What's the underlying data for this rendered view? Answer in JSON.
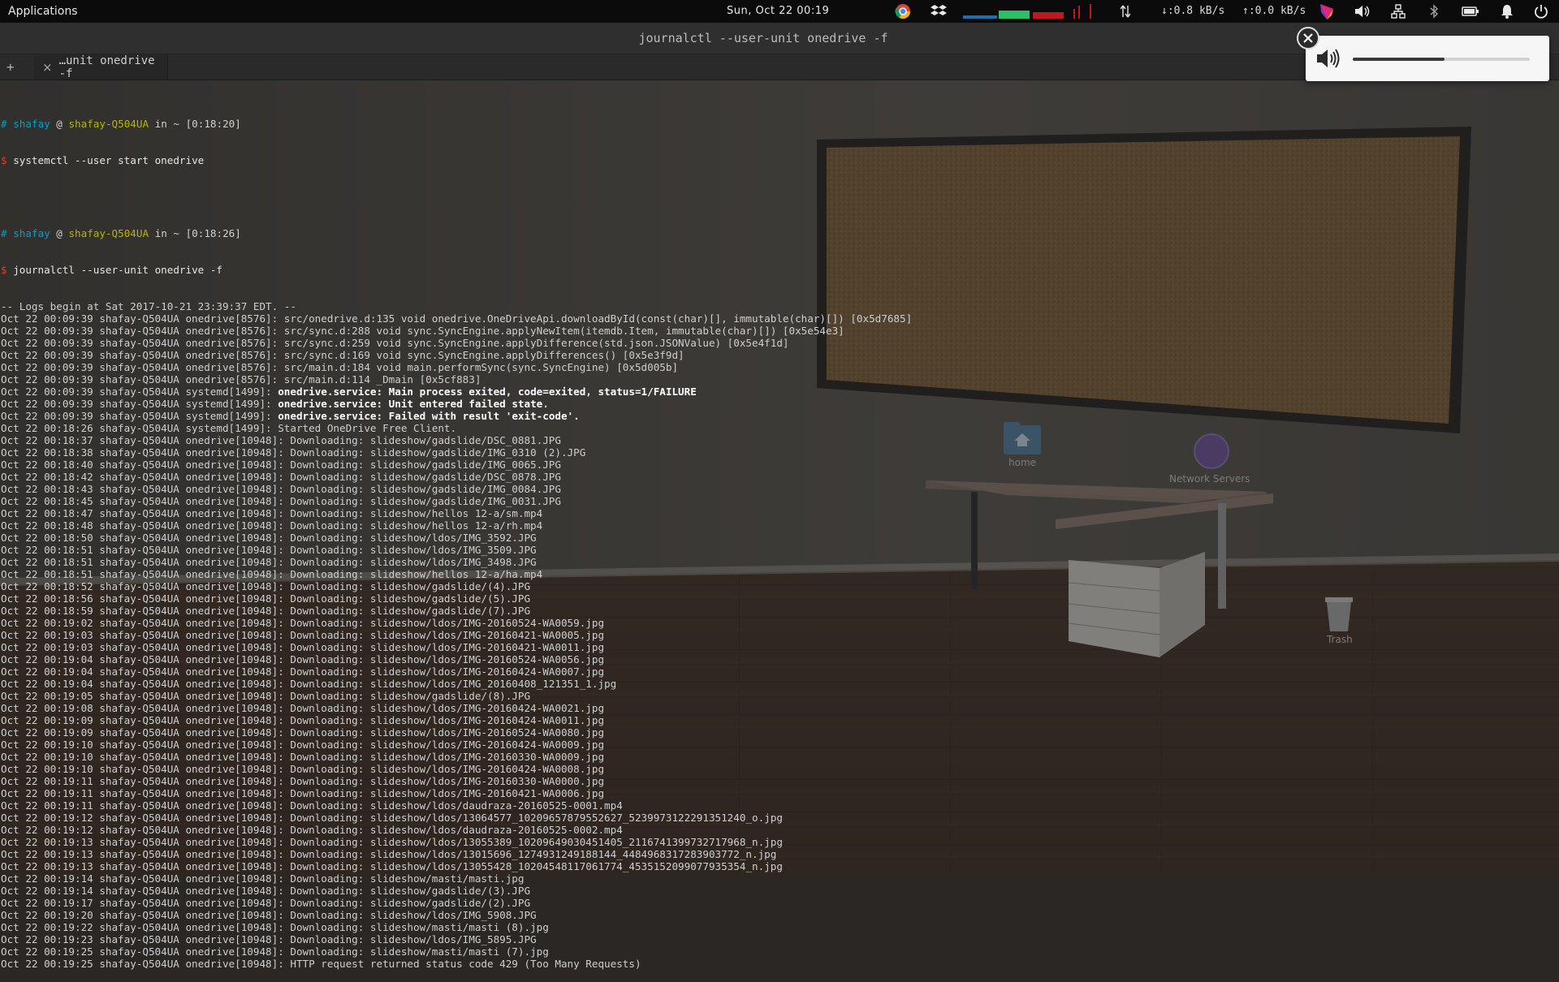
{
  "panel": {
    "apps_label": "Applications",
    "clock": "Sun, Oct 22  00:19",
    "download_speed": "↓:0.8 kB/s",
    "upload_speed": "↑:0.0 kB/s"
  },
  "terminal": {
    "title": "journalctl --user-unit onedrive -f",
    "new_tab_symbol": "+",
    "close_tab_symbol": "×",
    "tab_label": "…unit onedrive -f",
    "prompts": [
      {
        "hash": "#",
        "user": "shafay",
        "at": "@",
        "host": "shafay-Q504UA",
        "in": "in",
        "path": "~",
        "time": "[0:18:20]",
        "dollar": "$",
        "command": "systemctl --user start onedrive"
      },
      {
        "hash": "#",
        "user": "shafay",
        "at": "@",
        "host": "shafay-Q504UA",
        "in": "in",
        "path": "~",
        "time": "[0:18:26]",
        "dollar": "$",
        "command": "journalctl --user-unit onedrive -f"
      }
    ],
    "log_lines": [
      "-- Logs begin at Sat 2017-10-21 23:39:37 EDT. --",
      "Oct 22 00:09:39 shafay-Q504UA onedrive[8576]: src/onedrive.d:135 void onedrive.OneDriveApi.downloadById(const(char)[], immutable(char)[]) [0x5d7685]",
      "Oct 22 00:09:39 shafay-Q504UA onedrive[8576]: src/sync.d:288 void sync.SyncEngine.applyNewItem(itemdb.Item, immutable(char)[]) [0x5e54e3]",
      "Oct 22 00:09:39 shafay-Q504UA onedrive[8576]: src/sync.d:259 void sync.SyncEngine.applyDifference(std.json.JSONValue) [0x5e4f1d]",
      "Oct 22 00:09:39 shafay-Q504UA onedrive[8576]: src/sync.d:169 void sync.SyncEngine.applyDifferences() [0x5e3f9d]",
      "Oct 22 00:09:39 shafay-Q504UA onedrive[8576]: src/main.d:184 void main.performSync(sync.SyncEngine) [0x5d005b]",
      "Oct 22 00:09:39 shafay-Q504UA onedrive[8576]: src/main.d:114 _Dmain [0x5cf883]",
      {
        "prefix": "Oct 22 00:09:39 shafay-Q504UA systemd[1499]: ",
        "bold": "onedrive.service: Main process exited, code=exited, status=1/FAILURE"
      },
      {
        "prefix": "Oct 22 00:09:39 shafay-Q504UA systemd[1499]: ",
        "bold": "onedrive.service: Unit entered failed state."
      },
      {
        "prefix": "Oct 22 00:09:39 shafay-Q504UA systemd[1499]: ",
        "bold": "onedrive.service: Failed with result 'exit-code'."
      },
      "Oct 22 00:18:26 shafay-Q504UA systemd[1499]: Started OneDrive Free Client.",
      "Oct 22 00:18:37 shafay-Q504UA onedrive[10948]: Downloading: slideshow/gadslide/DSC_0881.JPG",
      "Oct 22 00:18:38 shafay-Q504UA onedrive[10948]: Downloading: slideshow/gadslide/IMG_0310 (2).JPG",
      "Oct 22 00:18:40 shafay-Q504UA onedrive[10948]: Downloading: slideshow/gadslide/IMG_0065.JPG",
      "Oct 22 00:18:42 shafay-Q504UA onedrive[10948]: Downloading: slideshow/gadslide/DSC_0878.JPG",
      "Oct 22 00:18:43 shafay-Q504UA onedrive[10948]: Downloading: slideshow/gadslide/IMG_0084.JPG",
      "Oct 22 00:18:45 shafay-Q504UA onedrive[10948]: Downloading: slideshow/gadslide/IMG_0031.JPG",
      "Oct 22 00:18:47 shafay-Q504UA onedrive[10948]: Downloading: slideshow/hellos 12-a/sm.mp4",
      "Oct 22 00:18:48 shafay-Q504UA onedrive[10948]: Downloading: slideshow/hellos 12-a/rh.mp4",
      "Oct 22 00:18:50 shafay-Q504UA onedrive[10948]: Downloading: slideshow/ldos/IMG_3592.JPG",
      "Oct 22 00:18:51 shafay-Q504UA onedrive[10948]: Downloading: slideshow/ldos/IMG_3509.JPG",
      "Oct 22 00:18:51 shafay-Q504UA onedrive[10948]: Downloading: slideshow/ldos/IMG_3498.JPG",
      "Oct 22 00:18:51 shafay-Q504UA onedrive[10948]: Downloading: slideshow/hellos 12-a/ha.mp4",
      "Oct 22 00:18:52 shafay-Q504UA onedrive[10948]: Downloading: slideshow/gadslide/(4).JPG",
      "Oct 22 00:18:56 shafay-Q504UA onedrive[10948]: Downloading: slideshow/gadslide/(5).JPG",
      "Oct 22 00:18:59 shafay-Q504UA onedrive[10948]: Downloading: slideshow/gadslide/(7).JPG",
      "Oct 22 00:19:02 shafay-Q504UA onedrive[10948]: Downloading: slideshow/ldos/IMG-20160524-WA0059.jpg",
      "Oct 22 00:19:03 shafay-Q504UA onedrive[10948]: Downloading: slideshow/ldos/IMG-20160421-WA0005.jpg",
      "Oct 22 00:19:03 shafay-Q504UA onedrive[10948]: Downloading: slideshow/ldos/IMG-20160421-WA0011.jpg",
      "Oct 22 00:19:04 shafay-Q504UA onedrive[10948]: Downloading: slideshow/ldos/IMG-20160524-WA0056.jpg",
      "Oct 22 00:19:04 shafay-Q504UA onedrive[10948]: Downloading: slideshow/ldos/IMG-20160424-WA0007.jpg",
      "Oct 22 00:19:04 shafay-Q504UA onedrive[10948]: Downloading: slideshow/ldos/IMG_20160408_121351_1.jpg",
      "Oct 22 00:19:05 shafay-Q504UA onedrive[10948]: Downloading: slideshow/gadslide/(8).JPG",
      "Oct 22 00:19:08 shafay-Q504UA onedrive[10948]: Downloading: slideshow/ldos/IMG-20160424-WA0021.jpg",
      "Oct 22 00:19:09 shafay-Q504UA onedrive[10948]: Downloading: slideshow/ldos/IMG-20160424-WA0011.jpg",
      "Oct 22 00:19:09 shafay-Q504UA onedrive[10948]: Downloading: slideshow/ldos/IMG-20160524-WA0080.jpg",
      "Oct 22 00:19:10 shafay-Q504UA onedrive[10948]: Downloading: slideshow/ldos/IMG-20160424-WA0009.jpg",
      "Oct 22 00:19:10 shafay-Q504UA onedrive[10948]: Downloading: slideshow/ldos/IMG-20160330-WA0009.jpg",
      "Oct 22 00:19:10 shafay-Q504UA onedrive[10948]: Downloading: slideshow/ldos/IMG-20160424-WA0008.jpg",
      "Oct 22 00:19:11 shafay-Q504UA onedrive[10948]: Downloading: slideshow/ldos/IMG-20160330-WA0000.jpg",
      "Oct 22 00:19:11 shafay-Q504UA onedrive[10948]: Downloading: slideshow/ldos/IMG-20160421-WA0006.jpg",
      "Oct 22 00:19:11 shafay-Q504UA onedrive[10948]: Downloading: slideshow/ldos/daudraza-20160525-0001.mp4",
      "Oct 22 00:19:12 shafay-Q504UA onedrive[10948]: Downloading: slideshow/ldos/13064577_10209657879552627_5239973122291351240_o.jpg",
      "Oct 22 00:19:12 shafay-Q504UA onedrive[10948]: Downloading: slideshow/ldos/daudraza-20160525-0002.mp4",
      "Oct 22 00:19:13 shafay-Q504UA onedrive[10948]: Downloading: slideshow/ldos/13055389_10209649030451405_2116741399732717968_n.jpg",
      "Oct 22 00:19:13 shafay-Q504UA onedrive[10948]: Downloading: slideshow/ldos/13015696_1274931249188144_4484968317283903772_n.jpg",
      "Oct 22 00:19:13 shafay-Q504UA onedrive[10948]: Downloading: slideshow/ldos/13055428_10204548117061774_4535152099077935354_n.jpg",
      "Oct 22 00:19:14 shafay-Q504UA onedrive[10948]: Downloading: slideshow/masti/masti.jpg",
      "Oct 22 00:19:14 shafay-Q504UA onedrive[10948]: Downloading: slideshow/gadslide/(3).JPG",
      "Oct 22 00:19:17 shafay-Q504UA onedrive[10948]: Downloading: slideshow/gadslide/(2).JPG",
      "Oct 22 00:19:20 shafay-Q504UA onedrive[10948]: Downloading: slideshow/ldos/IMG_5908.JPG",
      "Oct 22 00:19:22 shafay-Q504UA onedrive[10948]: Downloading: slideshow/masti/masti (8).jpg",
      "Oct 22 00:19:23 shafay-Q504UA onedrive[10948]: Downloading: slideshow/ldos/IMG_5895.JPG",
      "Oct 22 00:19:25 shafay-Q504UA onedrive[10948]: Downloading: slideshow/masti/masti (7).jpg",
      "Oct 22 00:19:25 shafay-Q504UA onedrive[10948]: HTTP request returned status code 429 (Too Many Requests)"
    ]
  },
  "volume": {
    "level": 0.52,
    "icon": "speaker-icon"
  },
  "desktop": {
    "home_label": "home",
    "network_label": "Network Servers",
    "trash_label": "Trash"
  },
  "tray_icons": [
    "chrome-icon",
    "dropbox-icon",
    "system-monitor-graph",
    "network-activity-icon",
    "color-picker-icon",
    "volume-icon",
    "network-icon",
    "bluetooth-icon",
    "battery-icon",
    "notification-bell-icon",
    "power-icon"
  ],
  "colors": {
    "prompt_user": "#00a0c8",
    "prompt_host": "#b5b500",
    "prompt_dollar": "#e04020",
    "panel_bg": "#0b0b0b",
    "cork": "#8a6637"
  }
}
